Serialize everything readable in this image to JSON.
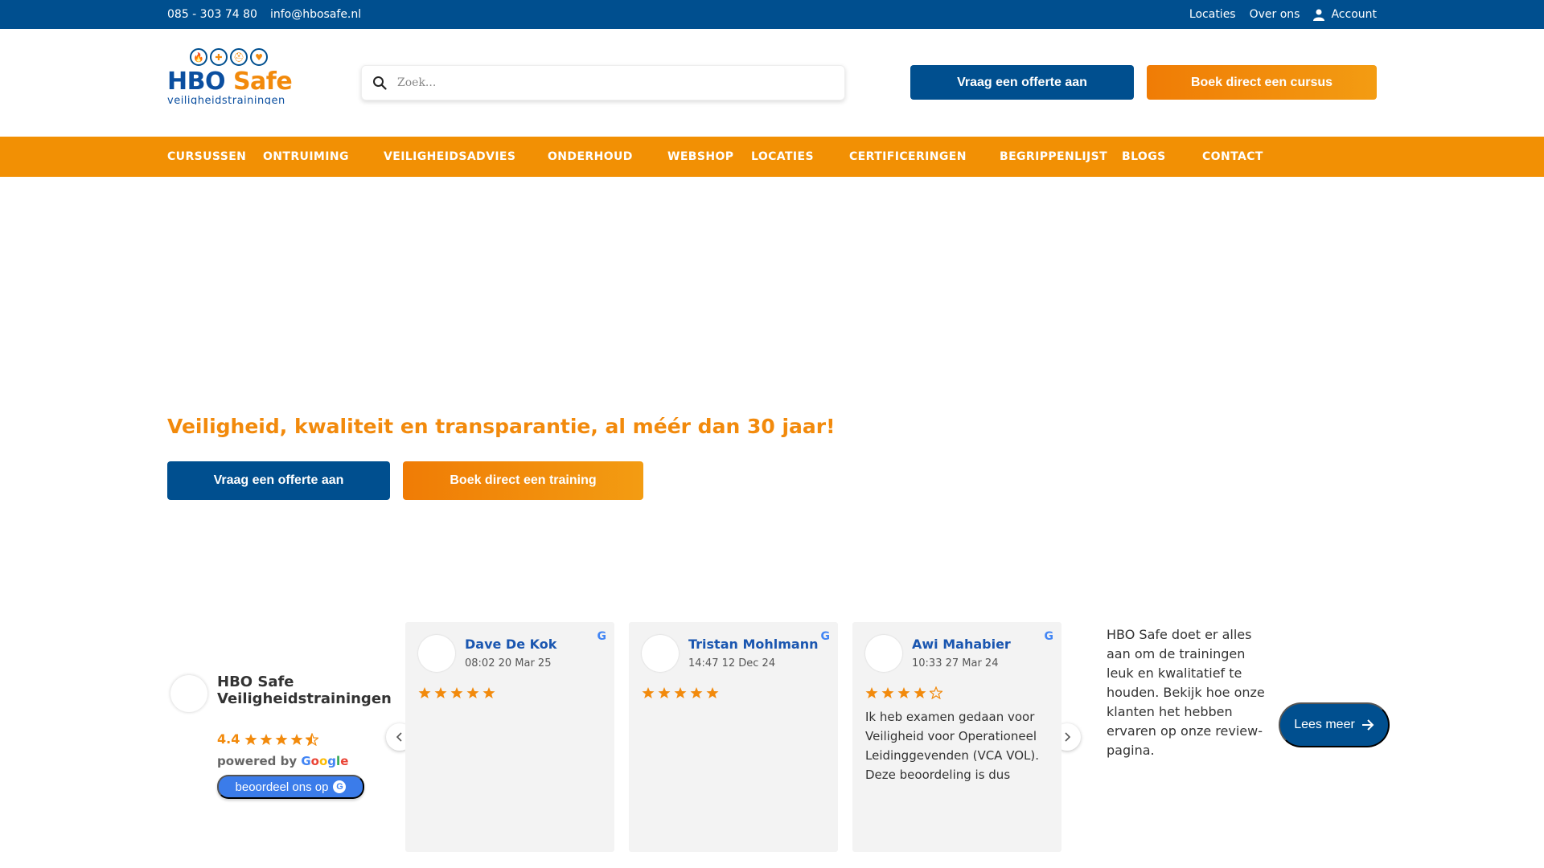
{
  "topbar": {
    "phone": "085 - 303 74 80",
    "email": "info@hbosafe.nl",
    "links": [
      "Locaties",
      "Over ons"
    ],
    "account": "Account"
  },
  "logo": {
    "hbo": "HBO",
    "safe": "Safe",
    "tagline": "veiligheidstrainingen"
  },
  "search": {
    "placeholder": "Zoek..."
  },
  "header": {
    "offer_button": "Vraag een offerte aan",
    "book_button": "Boek direct een cursus"
  },
  "nav": [
    "CURSUSSEN",
    "ONTRUIMING",
    "VEILIGHEIDSADVIES",
    "ONDERHOUD",
    "WEBSHOP",
    "LOCATIES",
    "CERTIFICERINGEN",
    "BEGRIPPENLIJST",
    "BLOGS",
    "CONTACT"
  ],
  "hero": {
    "title": "Veiligheid, kwaliteit en transparantie, al méér dan 30 jaar!",
    "offer_button": "Vraag een offerte aan",
    "book_button": "Boek direct een training"
  },
  "reviews_summary": {
    "name": "HBO Safe Veiligheidstrainingen",
    "rating": "4.4",
    "rating_value": 4.4,
    "powered_by": "powered by",
    "google": [
      "G",
      "o",
      "o",
      "g",
      "l",
      "e"
    ],
    "rate_button": "beoordeel ons op"
  },
  "reviews": [
    {
      "name": "Dave De Kok",
      "time": "08:02 20 Mar 25",
      "stars": 5,
      "text": ""
    },
    {
      "name": "Tristan Mohlmann",
      "time": "14:47 12 Dec 24",
      "stars": 5,
      "text": ""
    },
    {
      "name": "Awi Mahabier",
      "time": "10:33 27 Mar 24",
      "stars": 4,
      "text": "Ik heb examen gedaan voor Veiligheid voor Operationeel Leidinggevenden (VCA VOL). Deze beoordeling is dus"
    }
  ],
  "review_info": {
    "text": "HBO Safe doet er alles aan om de trainingen leuk en kwalitatief te houden. Bekijk hoe onze klanten het hebben ervaren op onze review-pagina.",
    "button": "Lees meer"
  },
  "colors": {
    "brand_blue": "#004f8f",
    "brand_orange": "#f29004",
    "star": "#f28a0c"
  }
}
